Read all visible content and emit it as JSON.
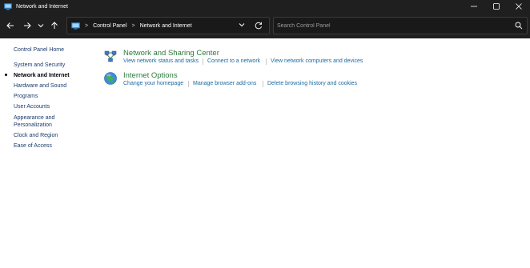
{
  "window": {
    "title": "Network and Internet",
    "minimize_icon": "minimize-icon",
    "maximize_icon": "maximize-icon",
    "close_icon": "close-icon"
  },
  "nav": {
    "back_icon": "back-arrow-icon",
    "forward_icon": "forward-arrow-icon",
    "recent_icon": "chevron-down-icon",
    "up_icon": "up-arrow-icon"
  },
  "address": {
    "breadcrumbs": [
      "Control Panel",
      "Network and Internet"
    ],
    "separator": ">",
    "dropdown_icon": "chevron-down-icon",
    "refresh_icon": "refresh-icon"
  },
  "search": {
    "placeholder": "Search Control Panel",
    "icon": "search-icon"
  },
  "sidebar": {
    "home": "Control Panel Home",
    "items": [
      {
        "label": "System and Security"
      },
      {
        "label": "Network and Internet",
        "selected": true
      },
      {
        "label": "Hardware and Sound"
      },
      {
        "label": "Programs"
      },
      {
        "label": "User Accounts"
      },
      {
        "label": "Appearance and"
      },
      {
        "label": "Personalization"
      },
      {
        "label": "Clock and Region"
      },
      {
        "label": "Ease of Access"
      }
    ]
  },
  "categories": [
    {
      "title": "Network and Sharing Center",
      "icon": "network-sharing-icon",
      "links": [
        "View network status and tasks",
        "Connect to a network",
        "View network computers and devices"
      ]
    },
    {
      "title": "Internet Options",
      "icon": "internet-options-globe-icon",
      "links": [
        "Change your homepage",
        "Manage browser add-ons",
        "Delete browsing history and cookies"
      ]
    }
  ],
  "colors": {
    "titlebar_bg": "#1f1f1f",
    "category_title": "#2b7a3a",
    "link": "#1c6aa0"
  }
}
